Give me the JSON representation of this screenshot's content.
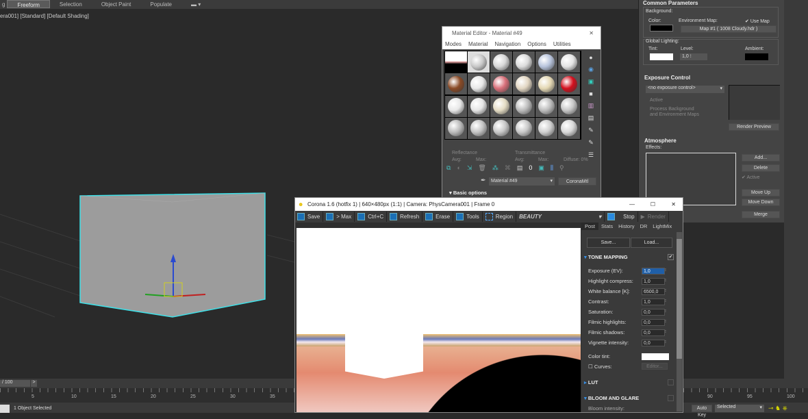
{
  "toolbar": {
    "tabs": [
      "Freeform",
      "Selection",
      "Object Paint",
      "Populate"
    ],
    "active": "Freeform",
    "prefix": "g"
  },
  "viewport": {
    "label": "era001] [Standard] [Default Shading]"
  },
  "environment": {
    "common_title": "Common Parameters",
    "background": "Background:",
    "color": "Color:",
    "env_map": "Environment Map:",
    "use_map": "Use Map",
    "map_button": "Map #1  ( 1008 Cloudy.hdr )",
    "global_lighting": "Global Lighting:",
    "tint": "Tint:",
    "level": "Level:",
    "level_value": "1,0",
    "ambient": "Ambient:",
    "exposure_title": "Exposure Control",
    "exposure_select": "<no exposure control>",
    "active": "Active",
    "process_bg": "Process Background",
    "process_bg2": "and Environment Maps",
    "render_preview": "Render Preview",
    "atmosphere_title": "Atmosphere",
    "effects": "Effects:",
    "add": "Add...",
    "delete": "Delete",
    "atm_active": "Active",
    "move_up": "Move Up",
    "move_down": "Move Down",
    "merge": "Merge"
  },
  "material_editor": {
    "title": "Material Editor - Material #49",
    "menu": [
      "Modes",
      "Material",
      "Navigation",
      "Options",
      "Utilities"
    ],
    "slot_colors": [
      "#ffffff",
      "#c8c8c8",
      "#d8d8d8",
      "#dcdcdc",
      "#b8c4dc",
      "#e4e4e4",
      "#8a4a26",
      "#e8e8e8",
      "#d8707a",
      "#e2d6c2",
      "#e4d8b4",
      "#d4101e",
      "#e8e8e8",
      "#e6e6e6",
      "#e4dcc4",
      "#bcbcbc",
      "#bdbdbd",
      "#c8c8c8",
      "#bcbcbc",
      "#c4c4c4",
      "#c8c8c8",
      "#c8c8c8",
      "#cfcfcf",
      "#d8d8d8"
    ],
    "reflectance": "Reflectance",
    "transmittance": "Transmittance",
    "avg": "Avg:",
    "max": "Max:",
    "diffuse": "Diffuse:  0%",
    "material_name": "Material #49",
    "material_type": "CoronaMtl",
    "basic_options": "Basic options"
  },
  "corona": {
    "title": "Corona 1.6 (hotfix 1) | 640×480px (1:1) | Camera: PhysCamera001 | Frame 0",
    "toolbar": [
      "Save",
      "> Max",
      "Ctrl+C",
      "Refresh",
      "Erase",
      "Tools",
      "Region"
    ],
    "channel": "BEAUTY",
    "stop": "Stop",
    "render": "Render",
    "tabs": [
      "Post",
      "Stats",
      "History",
      "DR",
      "LightMix"
    ],
    "save": "Save...",
    "load": "Load...",
    "tone_mapping": "TONE MAPPING",
    "params": [
      {
        "label": "Exposure (EV):",
        "value": "1,0"
      },
      {
        "label": "Highlight compress:",
        "value": "1,0"
      },
      {
        "label": "White balance [K]:",
        "value": "6500,0"
      },
      {
        "label": "Contrast:",
        "value": "1,0"
      },
      {
        "label": "Saturation:",
        "value": "0,0"
      },
      {
        "label": "Filmic highlights:",
        "value": "0,0"
      },
      {
        "label": "Filmic shadows:",
        "value": "0,0"
      },
      {
        "label": "Vignette intensity:",
        "value": "0,0"
      }
    ],
    "color_tint": "Color tint:",
    "curves": "Curves:",
    "editor": "Editor...",
    "lut": "LUT",
    "bloom": "BLOOM AND GLARE",
    "bloom_intensity": "Bloom intensity:"
  },
  "timeline": {
    "frame": "/ 100",
    "ticks_left": [
      "5",
      "10",
      "15",
      "20",
      "25",
      "30",
      "35"
    ],
    "ticks_right": [
      "90",
      "95",
      "100"
    ],
    "status": "1 Object Selected",
    "auto_key": "Auto Key",
    "selected": "Selected"
  }
}
